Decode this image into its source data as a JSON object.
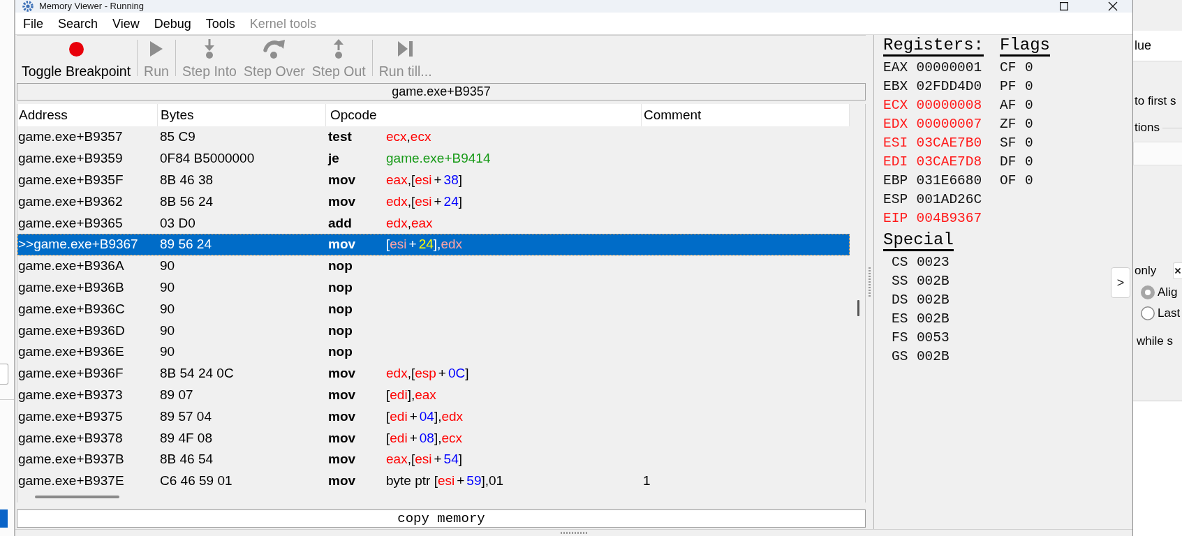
{
  "window": {
    "title": "Memory Viewer - Running"
  },
  "menu": [
    {
      "label": "File",
      "disabled": false
    },
    {
      "label": "Search",
      "disabled": false
    },
    {
      "label": "View",
      "disabled": false
    },
    {
      "label": "Debug",
      "disabled": false
    },
    {
      "label": "Tools",
      "disabled": false
    },
    {
      "label": "Kernel tools",
      "disabled": true
    }
  ],
  "toolbar": [
    {
      "buttons": [
        {
          "kind": "toggle_breakpoint",
          "label": "Toggle Breakpoint",
          "disabled": false
        }
      ]
    },
    {
      "buttons": [
        {
          "kind": "run",
          "label": "Run",
          "disabled": true
        }
      ]
    },
    {
      "buttons": [
        {
          "kind": "step_into",
          "label": "Step Into",
          "disabled": true
        },
        {
          "kind": "step_over",
          "label": "Step Over",
          "disabled": true
        },
        {
          "kind": "step_out",
          "label": "Step Out",
          "disabled": true
        }
      ]
    },
    {
      "buttons": [
        {
          "kind": "run_till",
          "label": "Run till...",
          "disabled": true
        }
      ]
    }
  ],
  "address_bar": {
    "value": "game.exe+B9357"
  },
  "table": {
    "columns": [
      "Address",
      "Bytes",
      "Opcode",
      "Comment"
    ],
    "rows": [
      {
        "address": "game.exe+B9357",
        "bytes": "85 C9",
        "opcode": "test",
        "operand": [
          {
            "text": "ecx",
            "kind": "register"
          },
          {
            "text": ",",
            "kind": "text"
          },
          {
            "text": "ecx",
            "kind": "register"
          }
        ],
        "selected": false
      },
      {
        "address": "game.exe+B9359",
        "bytes": "0F84 B5000000",
        "opcode": "je",
        "operand": [
          {
            "text": "game.exe+B9414",
            "kind": "symbol"
          }
        ],
        "selected": false
      },
      {
        "address": "game.exe+B935F",
        "bytes": "8B 46 38",
        "opcode": "mov",
        "operand": [
          {
            "text": "eax",
            "kind": "register"
          },
          {
            "text": ",[",
            "kind": "text"
          },
          {
            "text": "esi",
            "kind": "register"
          },
          {
            "text": "+",
            "kind": "operator"
          },
          {
            "text": "38",
            "kind": "number"
          },
          {
            "text": "]",
            "kind": "text"
          }
        ],
        "selected": false
      },
      {
        "address": "game.exe+B9362",
        "bytes": "8B 56 24",
        "opcode": "mov",
        "operand": [
          {
            "text": "edx",
            "kind": "register"
          },
          {
            "text": ",[",
            "kind": "text"
          },
          {
            "text": "esi",
            "kind": "register"
          },
          {
            "text": "+",
            "kind": "operator"
          },
          {
            "text": "24",
            "kind": "number"
          },
          {
            "text": "]",
            "kind": "text"
          }
        ],
        "selected": false
      },
      {
        "address": "game.exe+B9365",
        "bytes": "03 D0",
        "opcode": "add",
        "operand": [
          {
            "text": "edx",
            "kind": "register"
          },
          {
            "text": ",",
            "kind": "text"
          },
          {
            "text": "eax",
            "kind": "register"
          }
        ],
        "selected": false
      },
      {
        "address": ">>game.exe+B9367",
        "bytes": "89 56 24",
        "opcode": "mov",
        "operand": [
          {
            "text": "[",
            "kind": "text"
          },
          {
            "text": "esi",
            "kind": "register"
          },
          {
            "text": "+",
            "kind": "operator"
          },
          {
            "text": "24",
            "kind": "number"
          },
          {
            "text": "],",
            "kind": "text"
          },
          {
            "text": "edx",
            "kind": "register"
          }
        ],
        "selected": true
      },
      {
        "address": "game.exe+B936A",
        "bytes": "90",
        "opcode": "nop",
        "selected": false
      },
      {
        "address": "game.exe+B936B",
        "bytes": "90",
        "opcode": "nop",
        "selected": false
      },
      {
        "address": "game.exe+B936C",
        "bytes": "90",
        "opcode": "nop",
        "selected": false
      },
      {
        "address": "game.exe+B936D",
        "bytes": "90",
        "opcode": "nop",
        "selected": false
      },
      {
        "address": "game.exe+B936E",
        "bytes": "90",
        "opcode": "nop",
        "selected": false
      },
      {
        "address": "game.exe+B936F",
        "bytes": "8B 54 24 0C",
        "opcode": "mov",
        "operand": [
          {
            "text": "edx",
            "kind": "register"
          },
          {
            "text": ",[",
            "kind": "text"
          },
          {
            "text": "esp",
            "kind": "register"
          },
          {
            "text": "+",
            "kind": "operator"
          },
          {
            "text": "0C",
            "kind": "number"
          },
          {
            "text": "]",
            "kind": "text"
          }
        ],
        "selected": false
      },
      {
        "address": "game.exe+B9373",
        "bytes": "89 07",
        "opcode": "mov",
        "operand": [
          {
            "text": "[",
            "kind": "text"
          },
          {
            "text": "edi",
            "kind": "register"
          },
          {
            "text": "],",
            "kind": "text"
          },
          {
            "text": "eax",
            "kind": "register"
          }
        ],
        "selected": false
      },
      {
        "address": "game.exe+B9375",
        "bytes": "89 57 04",
        "opcode": "mov",
        "operand": [
          {
            "text": "[",
            "kind": "text"
          },
          {
            "text": "edi",
            "kind": "register"
          },
          {
            "text": "+",
            "kind": "operator"
          },
          {
            "text": "04",
            "kind": "number"
          },
          {
            "text": "],",
            "kind": "text"
          },
          {
            "text": "edx",
            "kind": "register"
          }
        ],
        "selected": false
      },
      {
        "address": "game.exe+B9378",
        "bytes": "89 4F 08",
        "opcode": "mov",
        "operand": [
          {
            "text": "[",
            "kind": "text"
          },
          {
            "text": "edi",
            "kind": "register"
          },
          {
            "text": "+",
            "kind": "operator"
          },
          {
            "text": "08",
            "kind": "number"
          },
          {
            "text": "],",
            "kind": "text"
          },
          {
            "text": "ecx",
            "kind": "register"
          }
        ],
        "selected": false
      },
      {
        "address": "game.exe+B937B",
        "bytes": "8B 46 54",
        "opcode": "mov",
        "operand": [
          {
            "text": "eax",
            "kind": "register"
          },
          {
            "text": ",[",
            "kind": "text"
          },
          {
            "text": "esi",
            "kind": "register"
          },
          {
            "text": "+",
            "kind": "operator"
          },
          {
            "text": "54",
            "kind": "number"
          },
          {
            "text": "]",
            "kind": "text"
          }
        ],
        "selected": false
      },
      {
        "address": "game.exe+B937E",
        "bytes": "C6 46 59 01",
        "opcode": "mov",
        "operand": [
          {
            "text": "byte ptr [",
            "kind": "text"
          },
          {
            "text": "esi",
            "kind": "register"
          },
          {
            "text": "+",
            "kind": "operator"
          },
          {
            "text": "59",
            "kind": "number"
          },
          {
            "text": "],01",
            "kind": "text"
          }
        ],
        "comment": "1",
        "selected": false
      }
    ]
  },
  "status_bar": {
    "text": "copy memory"
  },
  "registers": {
    "title": "Registers:",
    "items": [
      {
        "name": "EAX",
        "value": "00000001",
        "changed": false
      },
      {
        "name": "EBX",
        "value": "02FDD4D0",
        "changed": false
      },
      {
        "name": "ECX",
        "value": "00000008",
        "changed": true
      },
      {
        "name": "EDX",
        "value": "00000007",
        "changed": true
      },
      {
        "name": "ESI",
        "value": "03CAE7B0",
        "changed": true
      },
      {
        "name": "EDI",
        "value": "03CAE7D8",
        "changed": true
      },
      {
        "name": "EBP",
        "value": "031E6680",
        "changed": false
      },
      {
        "name": "ESP",
        "value": "001AD26C",
        "changed": false
      },
      {
        "name": "EIP",
        "value": "004B9367",
        "changed": true
      }
    ]
  },
  "flags": {
    "title": "Flags",
    "items": [
      {
        "name": "CF",
        "value": "0"
      },
      {
        "name": "PF",
        "value": "0"
      },
      {
        "name": "AF",
        "value": "0"
      },
      {
        "name": "ZF",
        "value": "0"
      },
      {
        "name": "SF",
        "value": "0"
      },
      {
        "name": "DF",
        "value": "0"
      },
      {
        "name": "OF",
        "value": "0"
      }
    ]
  },
  "special": {
    "title": "Special",
    "items": [
      {
        "name": "CS",
        "value": "0023"
      },
      {
        "name": "SS",
        "value": "002B"
      },
      {
        "name": "DS",
        "value": "002B"
      },
      {
        "name": "ES",
        "value": "002B"
      },
      {
        "name": "FS",
        "value": "0053"
      },
      {
        "name": "GS",
        "value": "002B"
      }
    ]
  },
  "stack_button": {
    "label": ">"
  },
  "background_window": {
    "column_header": "lue",
    "label_1": "to first s",
    "group_label": "tions",
    "label_2": "only",
    "radios": [
      {
        "label": "Alig",
        "selected": true
      },
      {
        "label": "Last",
        "selected": false
      }
    ],
    "label_3": "while s"
  }
}
